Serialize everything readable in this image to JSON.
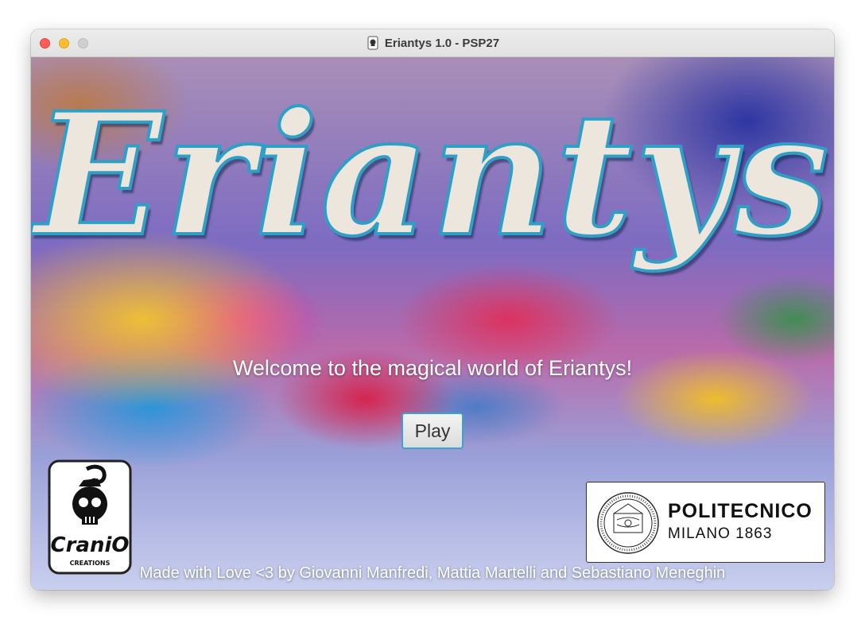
{
  "window": {
    "title": "Eriantys 1.0 - PSP27",
    "title_icon": "cranio-app-icon"
  },
  "main": {
    "logo_title": "Eriantys",
    "welcome_text": "Welcome to the magical world of Eriantys!",
    "play_label": "Play",
    "credits": "Made with Love <3 by Giovanni Manfredi, Mattia Martelli and Sebastiano Meneghin"
  },
  "cranio_logo": {
    "name": "CraniO",
    "sub": "CREATIONS"
  },
  "polimi_logo": {
    "name": "POLITECNICO",
    "city": "MILANO 1863"
  },
  "colors": {
    "button_border": "#3aa3d2",
    "title_stroke": "#2f9fc6"
  }
}
